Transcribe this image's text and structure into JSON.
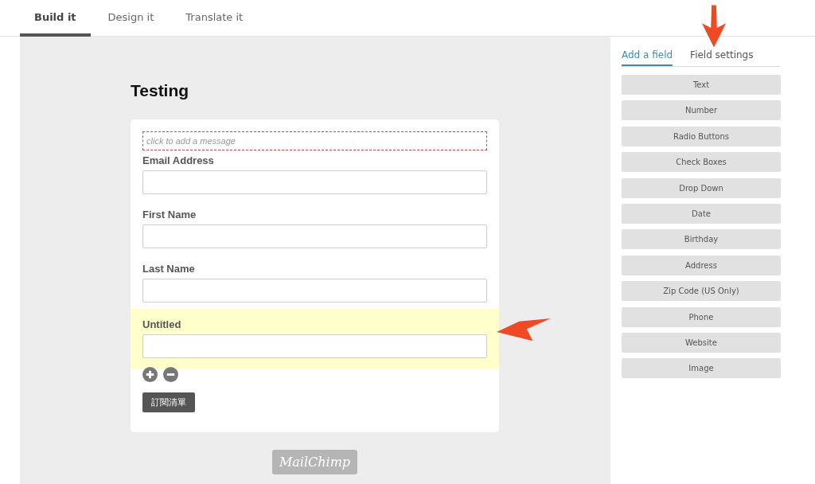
{
  "tabs": [
    {
      "label": "Build it",
      "selected": true
    },
    {
      "label": "Design it",
      "selected": false
    },
    {
      "label": "Translate it",
      "selected": false
    }
  ],
  "form": {
    "title": "Testing",
    "message_placeholder": "click to add a message",
    "fields": [
      {
        "label": "Email Address",
        "highlighted": false
      },
      {
        "label": "First Name",
        "highlighted": false
      },
      {
        "label": "Last Name",
        "highlighted": false
      },
      {
        "label": "Untitled",
        "highlighted": true
      }
    ],
    "submit": "訂閱清單",
    "badge": "MailChimp"
  },
  "panel": {
    "tabs": [
      {
        "label": "Add a field",
        "selected": true
      },
      {
        "label": "Field settings",
        "selected": false
      }
    ],
    "field_types": [
      "Text",
      "Number",
      "Radio Buttons",
      "Check Boxes",
      "Drop Down",
      "Date",
      "Birthday",
      "Address",
      "Zip Code (US Only)",
      "Phone",
      "Website",
      "Image"
    ]
  }
}
